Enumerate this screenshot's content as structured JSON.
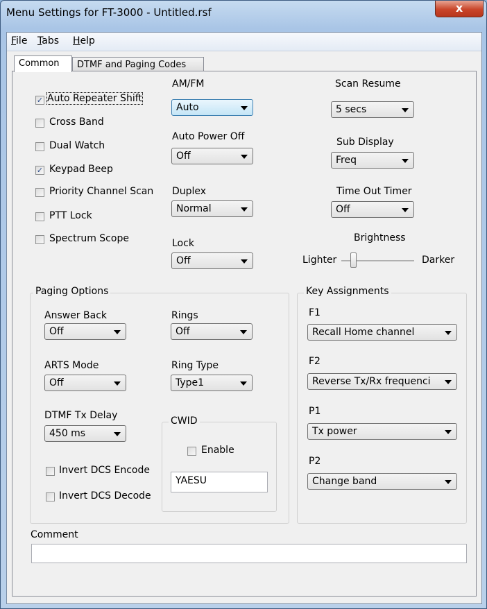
{
  "window": {
    "title": "Menu Settings for FT-3000 - Untitled.rsf",
    "close_label": "x"
  },
  "menu": {
    "file": "File",
    "file_key": "F",
    "file_rest": "ile",
    "tabs": "Tabs",
    "tabs_key": "T",
    "tabs_rest": "abs",
    "help": "Help",
    "help_key": "H",
    "help_rest": "elp"
  },
  "tabs": {
    "common": "Common",
    "dtmf": "DTMF and Paging Codes"
  },
  "checks": {
    "auto_repeater_shift": {
      "label": "Auto Repeater Shift",
      "checked": true
    },
    "cross_band": {
      "label": "Cross Band",
      "checked": false
    },
    "dual_watch": {
      "label": "Dual Watch",
      "checked": false
    },
    "keypad_beep": {
      "label": "Keypad Beep",
      "checked": true
    },
    "priority_scan": {
      "label": "Priority Channel Scan",
      "checked": false
    },
    "ptt_lock": {
      "label": "PTT Lock",
      "checked": false
    },
    "spectrum_scope": {
      "label": "Spectrum Scope",
      "checked": false
    }
  },
  "combos": {
    "am_fm": {
      "label": "AM/FM",
      "value": "Auto"
    },
    "auto_power_off": {
      "label": "Auto Power Off",
      "value": "Off"
    },
    "duplex": {
      "label": "Duplex",
      "value": "Normal"
    },
    "lock": {
      "label": "Lock",
      "value": "Off"
    },
    "scan_resume": {
      "label": "Scan Resume",
      "value": "5 secs"
    },
    "sub_display": {
      "label": "Sub Display",
      "value": "Freq"
    },
    "time_out_timer": {
      "label": "Time Out Timer",
      "value": "Off"
    }
  },
  "brightness": {
    "label": "Brightness",
    "left": "Lighter",
    "right": "Darker",
    "level": 0.16
  },
  "paging": {
    "title": "Paging Options",
    "answer_back": {
      "label": "Answer Back",
      "value": "Off"
    },
    "rings": {
      "label": "Rings",
      "value": "Off"
    },
    "arts_mode": {
      "label": "ARTS Mode",
      "value": "Off"
    },
    "ring_type": {
      "label": "Ring Type",
      "value": "Type1"
    },
    "dtmf_delay": {
      "label": "DTMF Tx Delay",
      "value": "450 ms"
    },
    "cwid_title": "CWID",
    "cwid_enable": "Enable",
    "cwid_text": "YAESU",
    "invert_encode": "Invert DCS Encode",
    "invert_decode": "Invert DCS Decode"
  },
  "keys": {
    "title": "Key Assignments",
    "f1": {
      "label": "F1",
      "value": "Recall Home channel"
    },
    "f2": {
      "label": "F2",
      "value": "Reverse Tx/Rx frequenci"
    },
    "p1": {
      "label": "P1",
      "value": "Tx power"
    },
    "p2": {
      "label": "P2",
      "value": "Change band"
    }
  },
  "comment": {
    "label": "Comment",
    "value": ""
  }
}
